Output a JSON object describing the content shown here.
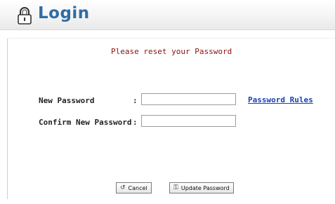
{
  "header": {
    "title": "Login",
    "icon": "lock-icon"
  },
  "form": {
    "message": "Please reset your Password",
    "new_password_label": "New Password",
    "confirm_password_label": "Confirm New Password",
    "colon": ":",
    "new_password_value": "",
    "confirm_password_value": "",
    "password_rules_link": "Password Rules"
  },
  "buttons": {
    "cancel_label": "Cancel",
    "cancel_icon": "cancel-icon",
    "update_label": "Update Password",
    "update_icon": "key-icon"
  },
  "colors": {
    "title": "#2f6da4",
    "message": "#8b1010",
    "link": "#1a3fb4"
  }
}
